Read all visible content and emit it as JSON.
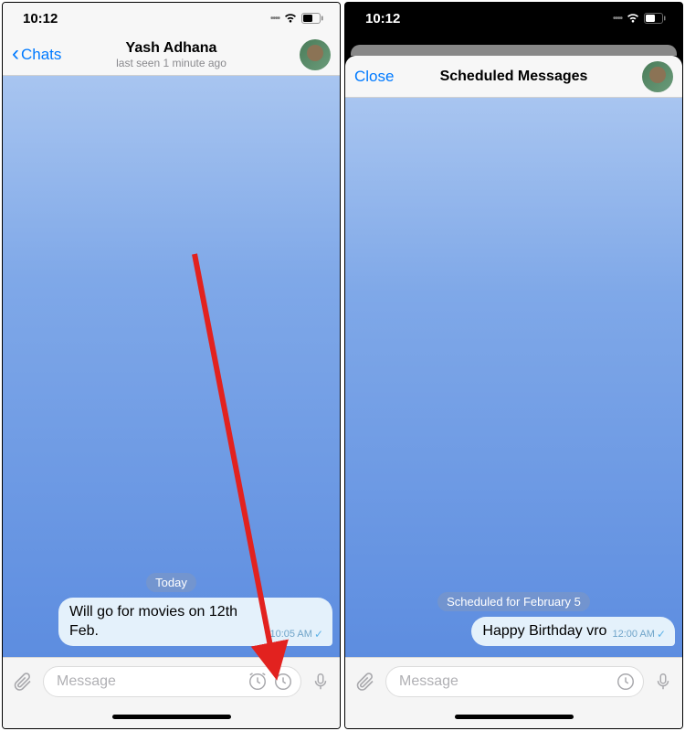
{
  "left": {
    "status": {
      "time": "10:12"
    },
    "nav": {
      "back_label": "Chats",
      "title": "Yash Adhana",
      "subtitle": "last seen 1 minute ago"
    },
    "chat": {
      "date_label": "Today",
      "message": {
        "text": "Will go for movies on 12th Feb.",
        "time": "10:05 AM"
      }
    },
    "input": {
      "placeholder": "Message"
    }
  },
  "right": {
    "status": {
      "time": "10:12"
    },
    "nav": {
      "close_label": "Close",
      "title": "Scheduled Messages"
    },
    "chat": {
      "date_label": "Scheduled for February 5",
      "message": {
        "text": "Happy Birthday vro",
        "time": "12:00 AM"
      }
    },
    "input": {
      "placeholder": "Message"
    }
  },
  "colors": {
    "accent": "#007aff"
  }
}
